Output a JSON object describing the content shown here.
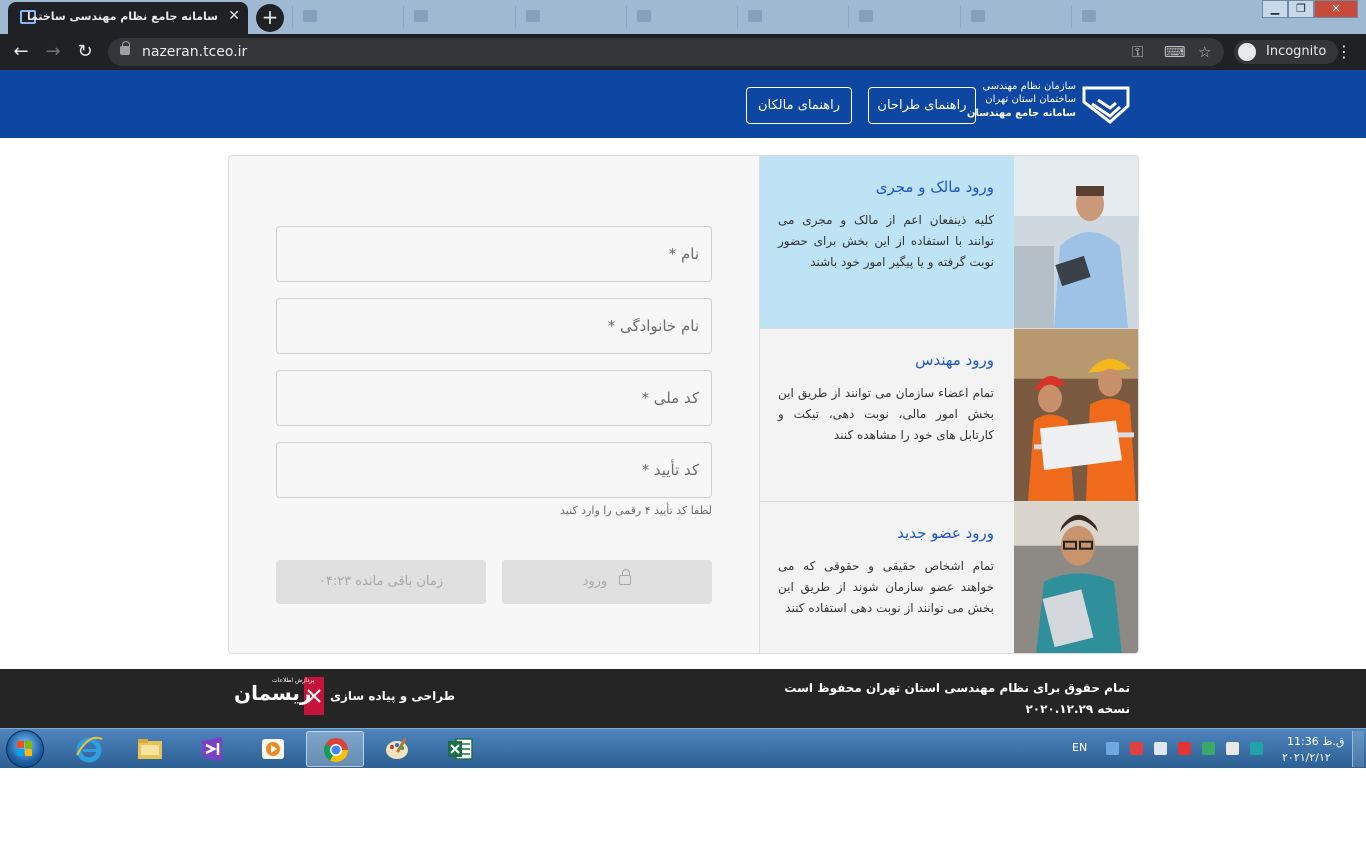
{
  "browser": {
    "active_tab_title": "سامانه جامع نظام مهندسی ساختمان تهران",
    "url": "nazeran.tceo.ir",
    "incognito_label": "Incognito",
    "icons": [
      "back-icon",
      "forward-icon",
      "reload-icon",
      "lock-icon",
      "key-icon",
      "translate-icon",
      "star-icon",
      "incognito-icon",
      "menu-icon"
    ]
  },
  "header": {
    "logo_line1": "سازمان نظام مهندسی",
    "logo_line2": "ساختمان استان تهران",
    "logo_line3": "سامانه جامع مهندسان",
    "guide_designer": "راهنمای طراحان",
    "guide_owner": "راهنمای مالکان",
    "brand_color": "#0e47a1"
  },
  "form": {
    "name_label": "نام *",
    "family_label": "نام خانوادگی *",
    "national_code_label": "کد ملی *",
    "verify_code_label": "کد تأیید *",
    "verify_hint": "لطفا کد تأیید ۴ رقمی را وارد کنید",
    "login_label": "ورود",
    "timer_label": "زمان باقی مانده ۰۴:۲۳"
  },
  "panels": {
    "owner": {
      "title": "ورود مالک و مجری",
      "description": "کلیه ذینفعان اعم از مالک و مجری می توانند با استفاده از این بخش برای حضور نوبت گرفته و یا پیگیر امور خود باشند",
      "color": "#bde3f5"
    },
    "engineer": {
      "title": "ورود مهندس",
      "description": "تمام اعضاء سازمان می توانند از طریق این بخش امور مالی، نوبت دهی، تیکت و کارتابل های خود را مشاهده کنند"
    },
    "member": {
      "title": "ورود عضو جدید",
      "description": "تمام اشخاص حقیقی و حقوقی که می خواهند عضو سازمان شوند از طریق این بخش می توانند از نوبت دهی استفاده کنند"
    },
    "title_color": "#1e56c8"
  },
  "footer": {
    "copyright": "تمام حقوق برای نظام مهندسی استان تهران محفوظ است",
    "version": "نسخه ۲۰۲۰.۱۲.۲۹",
    "designed_by": "طراحی و پیاده سازی",
    "brand_name": "ریسمان",
    "brand_tagline": "پردازش اطلاعات"
  },
  "taskbar": {
    "language": "EN",
    "time": "ق.ظ 11:36",
    "date": "۲۰۲۱/۲/۱۲",
    "apps": [
      "internet-explorer-icon",
      "file-explorer-icon",
      "visual-studio-icon",
      "media-player-icon",
      "chrome-icon",
      "paint-icon",
      "excel-icon"
    ]
  }
}
